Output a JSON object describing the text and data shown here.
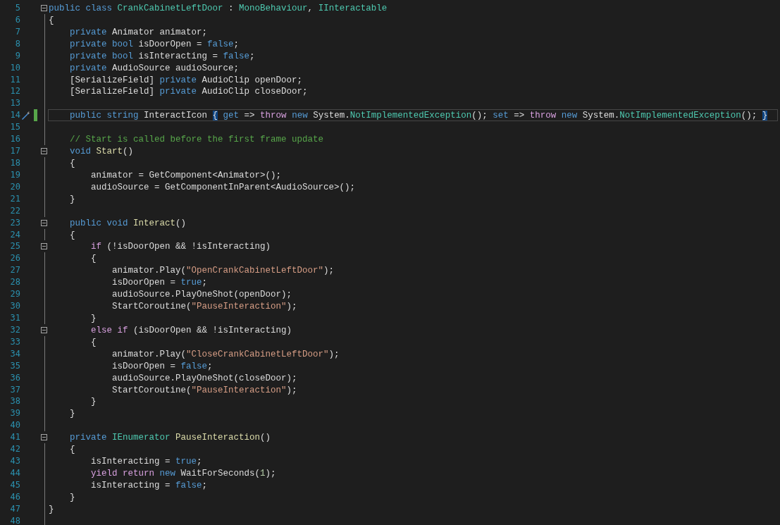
{
  "editor": {
    "lines": [
      {
        "number": "5",
        "selected": false,
        "fold": true,
        "modified": false,
        "quick_action": false,
        "tokens": [
          {
            "kind": "k",
            "text": "public class "
          },
          {
            "kind": "t",
            "text": "CrankCabinetLeftDoor"
          },
          {
            "kind": "p",
            "text": " : "
          },
          {
            "kind": "t",
            "text": "MonoBehaviour"
          },
          {
            "kind": "p",
            "text": ", "
          },
          {
            "kind": "t",
            "text": "IInteractable"
          }
        ]
      },
      {
        "number": "6",
        "selected": false,
        "fold": false,
        "modified": false,
        "quick_action": false,
        "tokens": [
          {
            "kind": "p",
            "text": "{"
          }
        ]
      },
      {
        "number": "7",
        "selected": false,
        "fold": false,
        "modified": false,
        "quick_action": false,
        "tokens": [
          {
            "kind": "k",
            "text": "    private "
          },
          {
            "kind": "p",
            "text": "Animator animator;"
          }
        ]
      },
      {
        "number": "8",
        "selected": false,
        "fold": false,
        "modified": false,
        "quick_action": false,
        "tokens": [
          {
            "kind": "k",
            "text": "    private bool "
          },
          {
            "kind": "p",
            "text": "isDoorOpen = "
          },
          {
            "kind": "k",
            "text": "false"
          },
          {
            "kind": "p",
            "text": ";"
          }
        ]
      },
      {
        "number": "9",
        "selected": false,
        "fold": false,
        "modified": false,
        "quick_action": false,
        "tokens": [
          {
            "kind": "k",
            "text": "    private bool "
          },
          {
            "kind": "p",
            "text": "isInteracting = "
          },
          {
            "kind": "k",
            "text": "false"
          },
          {
            "kind": "p",
            "text": ";"
          }
        ]
      },
      {
        "number": "10",
        "selected": false,
        "fold": false,
        "modified": false,
        "quick_action": false,
        "tokens": [
          {
            "kind": "k",
            "text": "    private "
          },
          {
            "kind": "p",
            "text": "AudioSource audioSource;"
          }
        ]
      },
      {
        "number": "11",
        "selected": false,
        "fold": false,
        "modified": false,
        "quick_action": false,
        "tokens": [
          {
            "kind": "p",
            "text": "    [SerializeField] "
          },
          {
            "kind": "k",
            "text": "private "
          },
          {
            "kind": "p",
            "text": "AudioClip openDoor;"
          }
        ]
      },
      {
        "number": "12",
        "selected": false,
        "fold": false,
        "modified": false,
        "quick_action": false,
        "tokens": [
          {
            "kind": "p",
            "text": "    [SerializeField] "
          },
          {
            "kind": "k",
            "text": "private "
          },
          {
            "kind": "p",
            "text": "AudioClip closeDoor;"
          }
        ]
      },
      {
        "number": "13",
        "selected": false,
        "fold": false,
        "modified": false,
        "quick_action": false
      },
      {
        "number": "14",
        "selected": true,
        "fold": false,
        "modified": true,
        "quick_action": true,
        "tokens": [
          {
            "kind": "k",
            "text": "    public string "
          },
          {
            "kind": "p",
            "text": "InteractIcon "
          },
          {
            "kind": "b",
            "text": "{"
          },
          {
            "kind": "k",
            "text": " get"
          },
          {
            "kind": "p",
            "text": " => "
          },
          {
            "kind": "c",
            "text": "throw "
          },
          {
            "kind": "k",
            "text": "new "
          },
          {
            "kind": "p",
            "text": "System."
          },
          {
            "kind": "t",
            "text": "NotImplementedException"
          },
          {
            "kind": "p",
            "text": "(); "
          },
          {
            "kind": "k",
            "text": "set"
          },
          {
            "kind": "p",
            "text": " => "
          },
          {
            "kind": "c",
            "text": "throw "
          },
          {
            "kind": "k",
            "text": "new "
          },
          {
            "kind": "p",
            "text": "System."
          },
          {
            "kind": "t",
            "text": "NotImplementedException"
          },
          {
            "kind": "p",
            "text": "(); "
          },
          {
            "kind": "b",
            "text": "}"
          }
        ]
      },
      {
        "number": "15",
        "selected": false,
        "fold": false,
        "modified": false,
        "quick_action": false
      },
      {
        "number": "16",
        "selected": false,
        "fold": false,
        "modified": false,
        "quick_action": false,
        "tokens": [
          {
            "kind": "g",
            "text": "    // Start is called before the first frame update"
          }
        ]
      },
      {
        "number": "17",
        "selected": false,
        "fold": true,
        "modified": false,
        "quick_action": false,
        "tokens": [
          {
            "kind": "k",
            "text": "    void "
          },
          {
            "kind": "m",
            "text": "Start"
          },
          {
            "kind": "p",
            "text": "()"
          }
        ]
      },
      {
        "number": "18",
        "selected": false,
        "fold": false,
        "modified": false,
        "quick_action": false,
        "tokens": [
          {
            "kind": "p",
            "text": "    {"
          }
        ]
      },
      {
        "number": "19",
        "selected": false,
        "fold": false,
        "modified": false,
        "quick_action": false,
        "tokens": [
          {
            "kind": "p",
            "text": "        animator = GetComponent<Animator>();"
          }
        ]
      },
      {
        "number": "20",
        "selected": false,
        "fold": false,
        "modified": false,
        "quick_action": false,
        "tokens": [
          {
            "kind": "p",
            "text": "        audioSource = GetComponentInParent<AudioSource>();"
          }
        ]
      },
      {
        "number": "21",
        "selected": false,
        "fold": false,
        "modified": false,
        "quick_action": false,
        "tokens": [
          {
            "kind": "p",
            "text": "    }"
          }
        ]
      },
      {
        "number": "22",
        "selected": false,
        "fold": false,
        "modified": false,
        "quick_action": false
      },
      {
        "number": "23",
        "selected": false,
        "fold": true,
        "modified": false,
        "quick_action": false,
        "tokens": [
          {
            "kind": "k",
            "text": "    public void "
          },
          {
            "kind": "m",
            "text": "Interact"
          },
          {
            "kind": "p",
            "text": "()"
          }
        ]
      },
      {
        "number": "24",
        "selected": false,
        "fold": false,
        "modified": false,
        "quick_action": false,
        "tokens": [
          {
            "kind": "p",
            "text": "    {"
          }
        ]
      },
      {
        "number": "25",
        "selected": false,
        "fold": true,
        "modified": false,
        "quick_action": false,
        "tokens": [
          {
            "kind": "c",
            "text": "        if "
          },
          {
            "kind": "p",
            "text": "(!isDoorOpen && !isInteracting)"
          }
        ]
      },
      {
        "number": "26",
        "selected": false,
        "fold": false,
        "modified": false,
        "quick_action": false,
        "tokens": [
          {
            "kind": "p",
            "text": "        {"
          }
        ]
      },
      {
        "number": "27",
        "selected": false,
        "fold": false,
        "modified": false,
        "quick_action": false,
        "tokens": [
          {
            "kind": "p",
            "text": "            animator.Play("
          },
          {
            "kind": "s",
            "text": "\"OpenCrankCabinetLeftDoor\""
          },
          {
            "kind": "p",
            "text": ");"
          }
        ]
      },
      {
        "number": "28",
        "selected": false,
        "fold": false,
        "modified": false,
        "quick_action": false,
        "tokens": [
          {
            "kind": "p",
            "text": "            isDoorOpen = "
          },
          {
            "kind": "k",
            "text": "true"
          },
          {
            "kind": "p",
            "text": ";"
          }
        ]
      },
      {
        "number": "29",
        "selected": false,
        "fold": false,
        "modified": false,
        "quick_action": false,
        "tokens": [
          {
            "kind": "p",
            "text": "            audioSource.PlayOneShot(openDoor);"
          }
        ]
      },
      {
        "number": "30",
        "selected": false,
        "fold": false,
        "modified": false,
        "quick_action": false,
        "tokens": [
          {
            "kind": "p",
            "text": "            StartCoroutine("
          },
          {
            "kind": "s",
            "text": "\"PauseInteraction\""
          },
          {
            "kind": "p",
            "text": ");"
          }
        ]
      },
      {
        "number": "31",
        "selected": false,
        "fold": false,
        "modified": false,
        "quick_action": false,
        "tokens": [
          {
            "kind": "p",
            "text": "        }"
          }
        ]
      },
      {
        "number": "32",
        "selected": false,
        "fold": true,
        "modified": false,
        "quick_action": false,
        "tokens": [
          {
            "kind": "c",
            "text": "        else if "
          },
          {
            "kind": "p",
            "text": "(isDoorOpen && !isInteracting)"
          }
        ]
      },
      {
        "number": "33",
        "selected": false,
        "fold": false,
        "modified": false,
        "quick_action": false,
        "tokens": [
          {
            "kind": "p",
            "text": "        {"
          }
        ]
      },
      {
        "number": "34",
        "selected": false,
        "fold": false,
        "modified": false,
        "quick_action": false,
        "tokens": [
          {
            "kind": "p",
            "text": "            animator.Play("
          },
          {
            "kind": "s",
            "text": "\"CloseCrankCabinetLeftDoor\""
          },
          {
            "kind": "p",
            "text": ");"
          }
        ]
      },
      {
        "number": "35",
        "selected": false,
        "fold": false,
        "modified": false,
        "quick_action": false,
        "tokens": [
          {
            "kind": "p",
            "text": "            isDoorOpen = "
          },
          {
            "kind": "k",
            "text": "false"
          },
          {
            "kind": "p",
            "text": ";"
          }
        ]
      },
      {
        "number": "36",
        "selected": false,
        "fold": false,
        "modified": false,
        "quick_action": false,
        "tokens": [
          {
            "kind": "p",
            "text": "            audioSource.PlayOneShot(closeDoor);"
          }
        ]
      },
      {
        "number": "37",
        "selected": false,
        "fold": false,
        "modified": false,
        "quick_action": false,
        "tokens": [
          {
            "kind": "p",
            "text": "            StartCoroutine("
          },
          {
            "kind": "s",
            "text": "\"PauseInteraction\""
          },
          {
            "kind": "p",
            "text": ");"
          }
        ]
      },
      {
        "number": "38",
        "selected": false,
        "fold": false,
        "modified": false,
        "quick_action": false,
        "tokens": [
          {
            "kind": "p",
            "text": "        }"
          }
        ]
      },
      {
        "number": "39",
        "selected": false,
        "fold": false,
        "modified": false,
        "quick_action": false,
        "tokens": [
          {
            "kind": "p",
            "text": "    }"
          }
        ]
      },
      {
        "number": "40",
        "selected": false,
        "fold": false,
        "modified": false,
        "quick_action": false
      },
      {
        "number": "41",
        "selected": false,
        "fold": true,
        "modified": false,
        "quick_action": false,
        "tokens": [
          {
            "kind": "k",
            "text": "    private "
          },
          {
            "kind": "t",
            "text": "IEnumerator "
          },
          {
            "kind": "m",
            "text": "PauseInteraction"
          },
          {
            "kind": "p",
            "text": "()"
          }
        ]
      },
      {
        "number": "42",
        "selected": false,
        "fold": false,
        "modified": false,
        "quick_action": false,
        "tokens": [
          {
            "kind": "p",
            "text": "    {"
          }
        ]
      },
      {
        "number": "43",
        "selected": false,
        "fold": false,
        "modified": false,
        "quick_action": false,
        "tokens": [
          {
            "kind": "p",
            "text": "        isInteracting = "
          },
          {
            "kind": "k",
            "text": "true"
          },
          {
            "kind": "p",
            "text": ";"
          }
        ]
      },
      {
        "number": "44",
        "selected": false,
        "fold": false,
        "modified": false,
        "quick_action": false,
        "tokens": [
          {
            "kind": "c",
            "text": "        yield return "
          },
          {
            "kind": "k",
            "text": "new "
          },
          {
            "kind": "p",
            "text": "WaitForSeconds("
          },
          {
            "kind": "n",
            "text": "1"
          },
          {
            "kind": "p",
            "text": ");"
          }
        ]
      },
      {
        "number": "45",
        "selected": false,
        "fold": false,
        "modified": false,
        "quick_action": false,
        "tokens": [
          {
            "kind": "p",
            "text": "        isInteracting = "
          },
          {
            "kind": "k",
            "text": "false"
          },
          {
            "kind": "p",
            "text": ";"
          }
        ]
      },
      {
        "number": "46",
        "selected": false,
        "fold": false,
        "modified": false,
        "quick_action": false,
        "tokens": [
          {
            "kind": "p",
            "text": "    }"
          }
        ]
      },
      {
        "number": "47",
        "selected": false,
        "fold": false,
        "modified": false,
        "quick_action": false,
        "tokens": [
          {
            "kind": "p",
            "text": "}"
          }
        ]
      },
      {
        "number": "48",
        "selected": false,
        "fold": false,
        "modified": false,
        "quick_action": false
      }
    ]
  }
}
